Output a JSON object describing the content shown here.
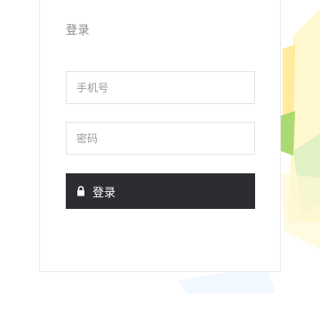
{
  "card": {
    "title": "登录"
  },
  "form": {
    "phone_placeholder": "手机号",
    "password_placeholder": "密码",
    "submit_label": "登录",
    "submit_icon": "lock-icon"
  },
  "colors": {
    "button_bg": "#2b2d30",
    "button_text": "#ffffff",
    "deco_yellow": "#fff3b3",
    "deco_green": "#a8d86a"
  }
}
